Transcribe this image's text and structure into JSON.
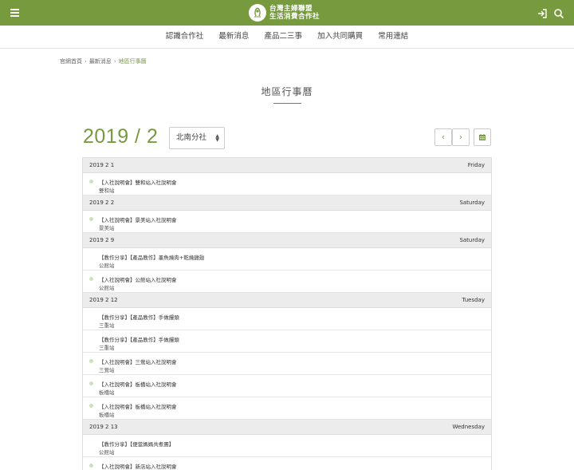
{
  "header": {
    "logo_line1": "台灣主婦聯盟",
    "logo_line2": "生活消費合作社"
  },
  "nav": {
    "items": [
      "認識合作社",
      "最新消息",
      "產品二三事",
      "加入共同購買",
      "常用連結"
    ]
  },
  "breadcrumb": {
    "home": "官網首頁",
    "news": "最新消息",
    "current": "地區行事曆"
  },
  "page": {
    "title": "地區行事曆"
  },
  "toolbar": {
    "month": "2019 / 2",
    "branch": "北南分社",
    "prev": "‹",
    "next": "›"
  },
  "days": [
    {
      "date": "2019 2 1",
      "weekday": "Friday",
      "events": [
        {
          "title": "【入社說明會】雙和站入社說明會",
          "place": "雙和站",
          "dot": true
        }
      ]
    },
    {
      "date": "2019 2 2",
      "weekday": "Saturday",
      "events": [
        {
          "title": "【入社說明會】景美站入社說明會",
          "place": "景美站",
          "dot": true
        }
      ]
    },
    {
      "date": "2019 2 9",
      "weekday": "Saturday",
      "events": [
        {
          "title": "【教作分享】【產品教作】墨魚燒肉+乾燒雞翅",
          "place": "公館站",
          "dot": false
        },
        {
          "title": "【入社說明會】公館站入社說明會",
          "place": "公館站",
          "dot": true
        }
      ]
    },
    {
      "date": "2019 2 12",
      "weekday": "Tuesday",
      "events": [
        {
          "title": "【教作分享】【產品教作】手做饅頭",
          "place": "三重站",
          "dot": false
        },
        {
          "title": "【教作分享】【產品教作】手做饅頭",
          "place": "三重站",
          "dot": false
        },
        {
          "title": "【入社說明會】三鶯站入社說明會",
          "place": "三鶯站",
          "dot": true
        },
        {
          "title": "【入社說明會】板橋站入社說明會",
          "place": "板橋站",
          "dot": true
        },
        {
          "title": "【入社說明會】板橋站入社說明會",
          "place": "板橋站",
          "dot": true
        }
      ]
    },
    {
      "date": "2019 2 13",
      "weekday": "Wednesday",
      "events": [
        {
          "title": "【教作分享】【便當媽媽共煮團】",
          "place": "公館站",
          "dot": false
        },
        {
          "title": "【入社說明會】新店站入社說明會",
          "place": "",
          "dot": true
        }
      ]
    }
  ]
}
